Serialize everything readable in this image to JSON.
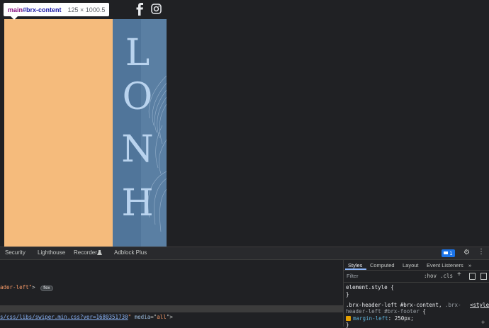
{
  "tooltip": {
    "tag": "main",
    "id": "#brx-content",
    "dims": "125 × 1000.5"
  },
  "hero": {
    "letters": [
      "L",
      "O",
      "N",
      "H"
    ]
  },
  "colors": {
    "orange": "#f5bb7c",
    "blue": "#50759a",
    "letters": "#b9d3ee"
  },
  "devtools": {
    "tabs": [
      "Security",
      "Lighthouse",
      "Recorder",
      "Adblock Plus"
    ],
    "issues_count": "1",
    "elements": {
      "line1_prefix": "ader-left\"",
      "line1_close": ">",
      "flex_badge": "flex",
      "css_link": "s/css/libs/swiper.min.css?ver=1680351730",
      "css_quote_close": "\"",
      "media_attr": "media",
      "media_eq": "=\"",
      "media_value": "all",
      "media_close": "\">"
    },
    "styles": {
      "subtabs": [
        "Styles",
        "Computed",
        "Layout",
        "Event Listeners",
        "»"
      ],
      "filter_placeholder": "Filter",
      "hov": ":hov",
      "cls": ".cls",
      "element_style": "element.style {",
      "close_brace": "}",
      "selector_active": ".brx-header-left #brx-content,",
      "selector_muted_1": ".brx-",
      "selector_muted_2": "header-left #brx-footer",
      "open_brace": "{",
      "source": "<style>",
      "prop": "margin-left",
      "colon": ":",
      "value": "250px",
      "semicolon": ";"
    }
  }
}
